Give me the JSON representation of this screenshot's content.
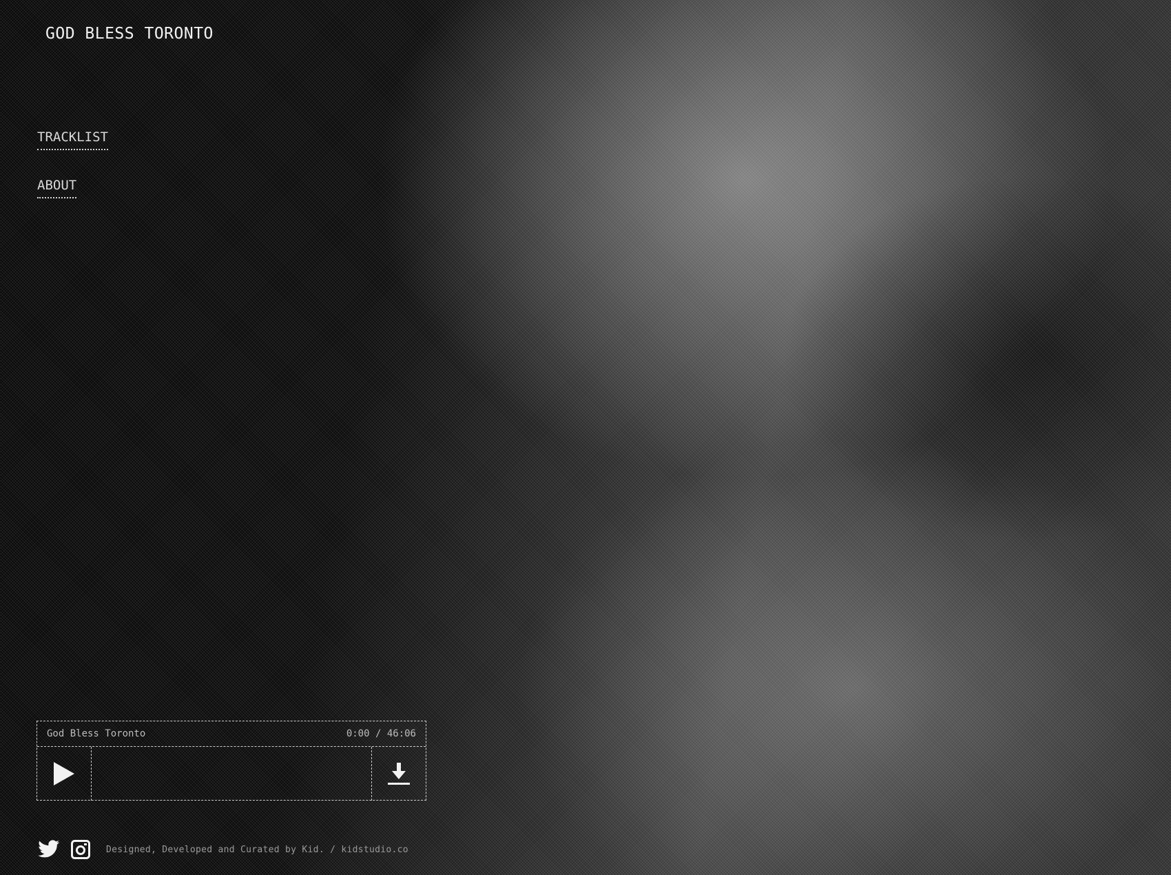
{
  "site": {
    "logo_text": "GOD BLESS TORONTO"
  },
  "nav": {
    "items": [
      {
        "label": "TRACKLIST"
      },
      {
        "label": "ABOUT"
      }
    ]
  },
  "player": {
    "track_title": "God Bless Toronto",
    "time_current": "0:00",
    "time_separator": "/",
    "time_total": "46:06",
    "progress": 0,
    "play_icon": "play-icon",
    "download_icon": "download-icon"
  },
  "footer": {
    "twitter_icon": "twitter-icon",
    "instagram_icon": "instagram-icon",
    "credit": "Designed, Developed and Curated by Kid. / kidstudio.co"
  },
  "colors": {
    "background": "#0c0c0c",
    "text": "#eaeaea",
    "border": "#cfcfcf"
  }
}
